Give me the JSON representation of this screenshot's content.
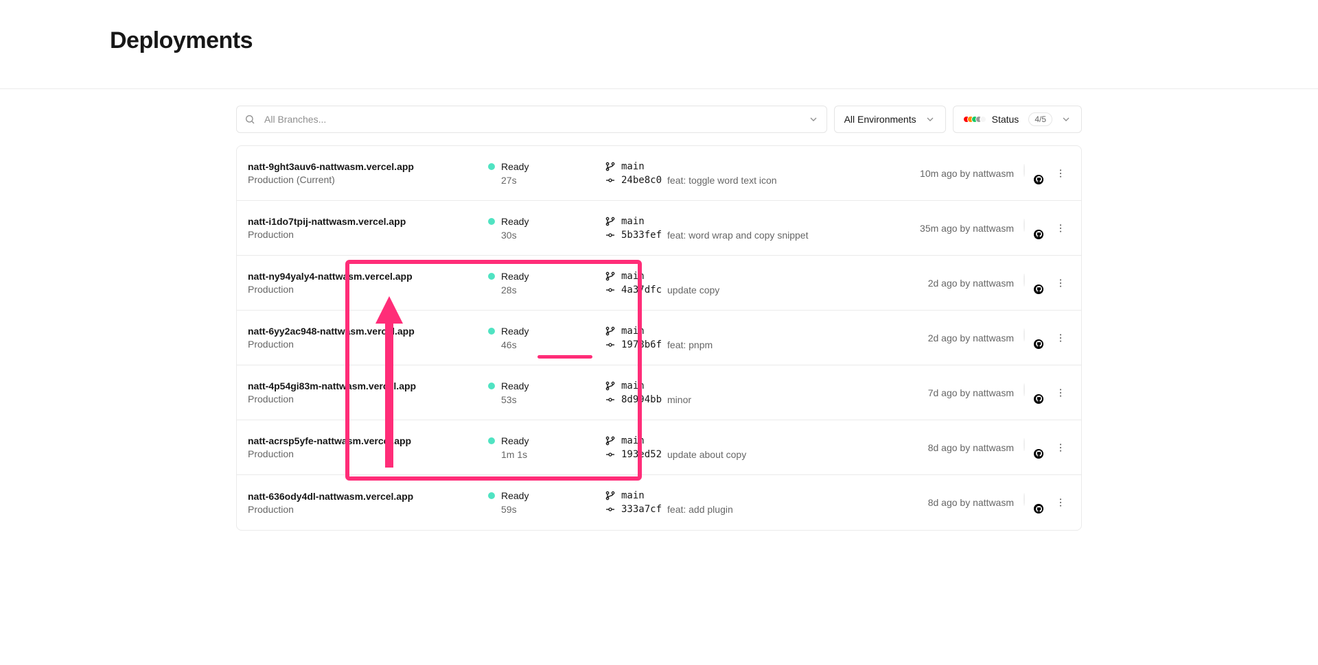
{
  "page": {
    "title": "Deployments"
  },
  "filters": {
    "search_placeholder": "All Branches...",
    "environments_label": "All Environments",
    "status_label": "Status",
    "status_count": "4/5",
    "status_colors": [
      "#ff0000",
      "#ff8a00",
      "#17c964",
      "#999999",
      "#f5f5f5"
    ]
  },
  "deployments": [
    {
      "url": "natt-9ght3auv6-nattwasm.vercel.app",
      "env": "Production (Current)",
      "status": "Ready",
      "duration": "27s",
      "branch": "main",
      "sha": "24be8c0",
      "message": "feat: toggle word text icon",
      "ago": "10m ago by nattwasm"
    },
    {
      "url": "natt-i1do7tpij-nattwasm.vercel.app",
      "env": "Production",
      "status": "Ready",
      "duration": "30s",
      "branch": "main",
      "sha": "5b33fef",
      "message": "feat: word wrap and copy snippet",
      "ago": "35m ago by nattwasm"
    },
    {
      "url": "natt-ny94yaly4-nattwasm.vercel.app",
      "env": "Production",
      "status": "Ready",
      "duration": "28s",
      "branch": "main",
      "sha": "4a37dfc",
      "message": "update copy",
      "ago": "2d ago by nattwasm"
    },
    {
      "url": "natt-6yy2ac948-nattwasm.vercel.app",
      "env": "Production",
      "status": "Ready",
      "duration": "46s",
      "branch": "main",
      "sha": "1978b6f",
      "message": "feat: pnpm",
      "ago": "2d ago by nattwasm"
    },
    {
      "url": "natt-4p54gi83m-nattwasm.vercel.app",
      "env": "Production",
      "status": "Ready",
      "duration": "53s",
      "branch": "main",
      "sha": "8d994bb",
      "message": "minor",
      "ago": "7d ago by nattwasm"
    },
    {
      "url": "natt-acrsp5yfe-nattwasm.vercel.app",
      "env": "Production",
      "status": "Ready",
      "duration": "1m 1s",
      "branch": "main",
      "sha": "193ed52",
      "message": "update about copy",
      "ago": "8d ago by nattwasm"
    },
    {
      "url": "natt-636ody4dl-nattwasm.vercel.app",
      "env": "Production",
      "status": "Ready",
      "duration": "59s",
      "branch": "main",
      "sha": "333a7cf",
      "message": "feat: add plugin",
      "ago": "8d ago by nattwasm"
    }
  ]
}
